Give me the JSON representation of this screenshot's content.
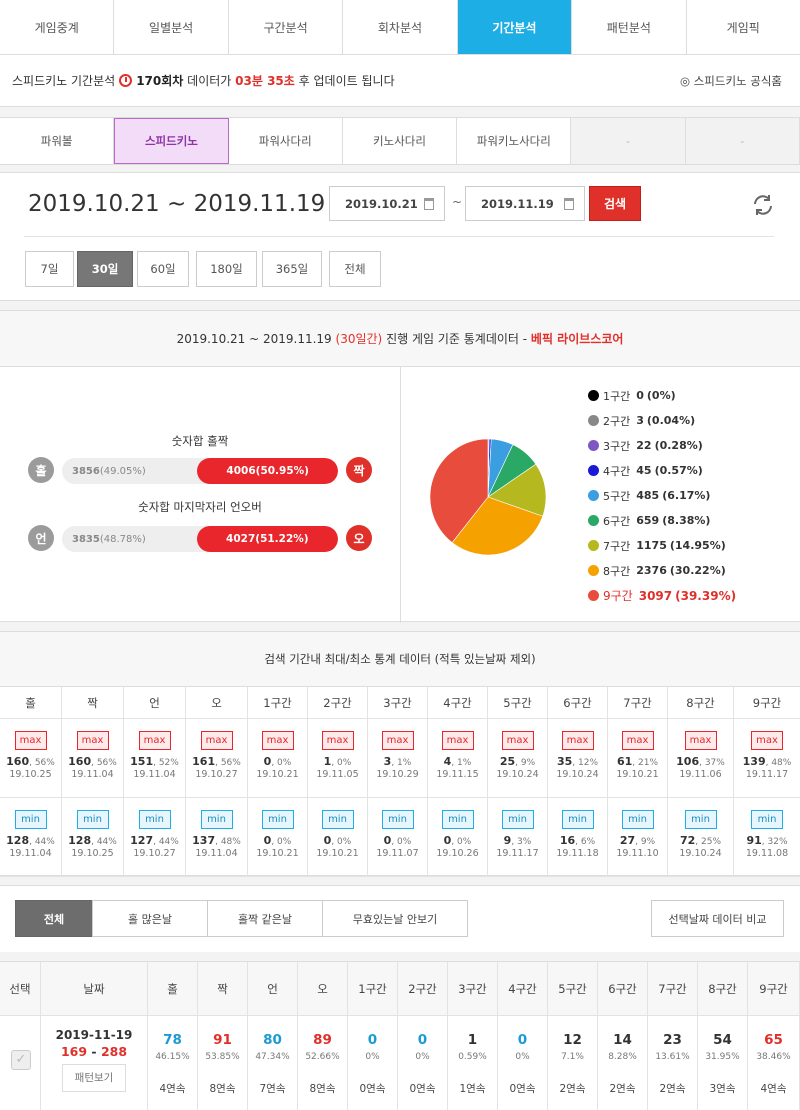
{
  "topnav": [
    "게임중계",
    "일별분석",
    "구간분석",
    "회차분석",
    "기간분석",
    "패턴분석",
    "게임픽"
  ],
  "topnav_active": 4,
  "info": {
    "prefix": "스피드키노 기간분석",
    "round": "170회차",
    "mid": "데이터가",
    "time": "03분 35초",
    "suffix": "후 업데이트 됩니다",
    "official": "스피드키노 공식홈"
  },
  "gametabs": [
    "파워볼",
    "스피드키노",
    "파워사다리",
    "키노사다리",
    "파워키노사다리",
    "-",
    "-"
  ],
  "gametab_active": 1,
  "range": {
    "title": "2019.10.21 ~ 2019.11.19",
    "from": "2019.10.21",
    "to": "2019.11.19",
    "tilde": "~",
    "search": "검색"
  },
  "periods": [
    "7일",
    "30일",
    "60일",
    "180일",
    "365일",
    "전체"
  ],
  "period_active": 1,
  "stats": {
    "range": "2019.10.21 ~ 2019.11.19",
    "days": "(30일간)",
    "mid": "진행 게임 기준 통계데이터 -",
    "brand": "베픽 라이브스코어"
  },
  "bars": [
    {
      "title": "숫자합 홀짝",
      "left_badge": "홀",
      "right_badge": "짝",
      "left": "3856",
      "left_pct": "(49.05%)",
      "right": "4006",
      "right_pct": "(50.95%)",
      "right_frac": 0.5095
    },
    {
      "title": "숫자합 마지막자리 언오버",
      "left_badge": "언",
      "right_badge": "오",
      "left": "3835",
      "left_pct": "(48.78%)",
      "right": "4027",
      "right_pct": "(51.22%)",
      "right_frac": 0.5122
    }
  ],
  "chart_data": {
    "type": "pie",
    "labels": [
      "1구간",
      "2구간",
      "3구간",
      "4구간",
      "5구간",
      "6구간",
      "7구간",
      "8구간",
      "9구간"
    ],
    "values": [
      0,
      3,
      22,
      45,
      485,
      659,
      1175,
      2376,
      3097
    ],
    "pct": [
      "(0%)",
      "(0.04%)",
      "(0.28%)",
      "(0.57%)",
      "(6.17%)",
      "(8.38%)",
      "(14.95%)",
      "(30.22%)",
      "(39.39%)"
    ],
    "colors": [
      "#000000",
      "#888888",
      "#7e57c2",
      "#1a1ad6",
      "#3a9ee0",
      "#2aa866",
      "#b6b81f",
      "#f5a200",
      "#e74c3c"
    ]
  },
  "mm": {
    "title": "검색 기간내 최대/최소 통계 데이터 (적특 있는날짜 제외)",
    "headers": [
      "홀",
      "짝",
      "언",
      "오",
      "1구간",
      "2구간",
      "3구간",
      "4구간",
      "5구간",
      "6구간",
      "7구간",
      "8구간",
      "9구간"
    ],
    "max_label": "max",
    "min_label": "min",
    "max": [
      [
        "160",
        ", 56%",
        "19.10.25"
      ],
      [
        "160",
        ", 56%",
        "19.11.04"
      ],
      [
        "151",
        ", 52%",
        "19.11.04"
      ],
      [
        "161",
        ", 56%",
        "19.10.27"
      ],
      [
        "0",
        ", 0%",
        "19.10.21"
      ],
      [
        "1",
        ", 0%",
        "19.11.05"
      ],
      [
        "3",
        ", 1%",
        "19.10.29"
      ],
      [
        "4",
        ", 1%",
        "19.11.15"
      ],
      [
        "25",
        ", 9%",
        "19.10.24"
      ],
      [
        "35",
        ", 12%",
        "19.10.24"
      ],
      [
        "61",
        ", 21%",
        "19.10.21"
      ],
      [
        "106",
        ", 37%",
        "19.11.06"
      ],
      [
        "139",
        ", 48%",
        "19.11.17"
      ]
    ],
    "min": [
      [
        "128",
        ", 44%",
        "19.11.04"
      ],
      [
        "128",
        ", 44%",
        "19.10.25"
      ],
      [
        "127",
        ", 44%",
        "19.10.27"
      ],
      [
        "137",
        ", 48%",
        "19.11.04"
      ],
      [
        "0",
        ", 0%",
        "19.10.21"
      ],
      [
        "0",
        ", 0%",
        "19.10.21"
      ],
      [
        "0",
        ", 0%",
        "19.11.07"
      ],
      [
        "0",
        ", 0%",
        "19.10.26"
      ],
      [
        "9",
        ", 3%",
        "19.11.17"
      ],
      [
        "16",
        ", 6%",
        "19.11.18"
      ],
      [
        "27",
        ", 9%",
        "19.11.10"
      ],
      [
        "72",
        ", 25%",
        "19.10.24"
      ],
      [
        "91",
        ", 32%",
        "19.11.08"
      ]
    ]
  },
  "filters": [
    "전체",
    "홀 많은날",
    "홀짝 같은날",
    "무효있는날 안보기"
  ],
  "compare": "선택날짜 데이터 비교",
  "table": {
    "headers": [
      "선택",
      "날짜",
      "홀",
      "짝",
      "언",
      "오",
      "1구간",
      "2구간",
      "3구간",
      "4구간",
      "5구간",
      "6구간",
      "7구간",
      "8구간",
      "9구간"
    ],
    "row": {
      "date": "2019-11-19",
      "r1": "169",
      "dash": " - ",
      "r2": "288",
      "pattern": "패턴보기",
      "cells": [
        [
          "78",
          "46.15%",
          "4연속",
          "blue"
        ],
        [
          "91",
          "53.85%",
          "8연속",
          "redt"
        ],
        [
          "80",
          "47.34%",
          "7연속",
          "blue"
        ],
        [
          "89",
          "52.66%",
          "8연속",
          "redt"
        ],
        [
          "0",
          "0%",
          "0연속",
          "blue"
        ],
        [
          "0",
          "0%",
          "0연속",
          "blue"
        ],
        [
          "1",
          "0.59%",
          "1연속",
          "dark"
        ],
        [
          "0",
          "0%",
          "0연속",
          "blue"
        ],
        [
          "12",
          "7.1%",
          "2연속",
          "dark"
        ],
        [
          "14",
          "8.28%",
          "2연속",
          "dark"
        ],
        [
          "23",
          "13.61%",
          "2연속",
          "dark"
        ],
        [
          "54",
          "31.95%",
          "3연속",
          "dark"
        ],
        [
          "65",
          "38.46%",
          "4연속",
          "redt"
        ]
      ]
    }
  }
}
